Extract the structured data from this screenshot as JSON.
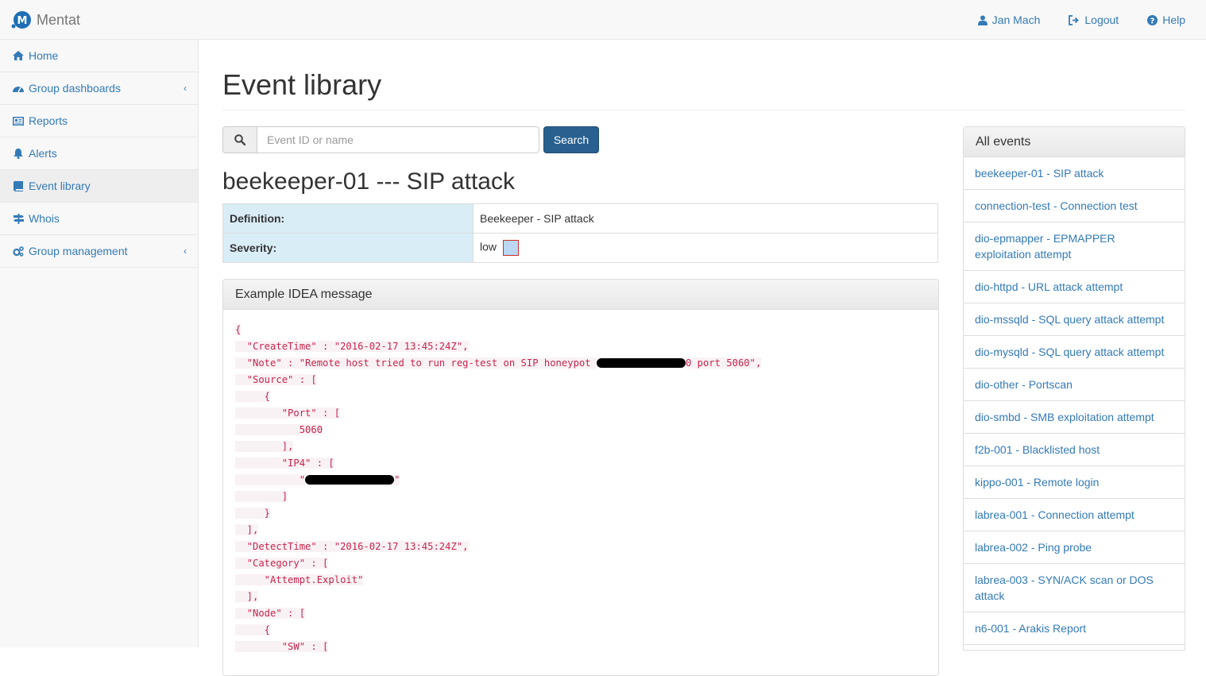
{
  "navbar": {
    "brand": "Mentat",
    "links": [
      {
        "label": "Jan Mach",
        "icon": "user-icon"
      },
      {
        "label": "Logout",
        "icon": "logout-icon"
      },
      {
        "label": "Help",
        "icon": "help-icon"
      }
    ]
  },
  "sidebar": {
    "items": [
      {
        "label": "Home",
        "icon": "home-icon"
      },
      {
        "label": "Group dashboards",
        "icon": "dashboard-icon",
        "has_submenu": true
      },
      {
        "label": "Reports",
        "icon": "newspaper-icon"
      },
      {
        "label": "Alerts",
        "icon": "bell-icon"
      },
      {
        "label": "Event library",
        "icon": "book-icon",
        "active": true
      },
      {
        "label": "Whois",
        "icon": "signpost-icon"
      },
      {
        "label": "Group management",
        "icon": "cogs-icon",
        "has_submenu": true
      }
    ],
    "chevron": "‹"
  },
  "main": {
    "title": "Event library",
    "search": {
      "placeholder": "Event ID or name",
      "button": "Search"
    },
    "event_title": "beekeeper-01 --- SIP attack",
    "definition_label": "Definition:",
    "definition_value": "Beekeeper - SIP attack",
    "severity_label": "Severity:",
    "severity_value": "low",
    "example_panel_title": "Example IDEA message",
    "code_lines": [
      "{",
      "  \"CreateTime\" : \"2016-02-17 13:45:24Z\",",
      "  \"Note\" : \"Remote host tried to run reg-test on SIP honeypot ",
      "  \"Source\" : [",
      "     {",
      "        \"Port\" : [",
      "           5060",
      "        ],",
      "        \"IP4\" : [",
      "           \"",
      "        ]",
      "     }",
      "  ],",
      "  \"DetectTime\" : \"2016-02-17 13:45:24Z\",",
      "  \"Category\" : [",
      "     \"Attempt.Exploit\"",
      "  ],",
      "  \"Node\" : [",
      "     {",
      "        \"SW\" : ["
    ],
    "note_line_suffix": "0 port 5060\",",
    "ip_line_suffix": "\""
  },
  "events_panel": {
    "title": "All events",
    "items": [
      "beekeeper-01 - SIP attack",
      "connection-test - Connection test",
      "dio-epmapper - EPMAPPER exploitation attempt",
      "dio-httpd - URL attack attempt",
      "dio-mssqld - SQL query attack attempt",
      "dio-mysqld - SQL query attack attempt",
      "dio-other - Portscan",
      "dio-smbd - SMB exploitation attempt",
      "f2b-001 - Blacklisted host",
      "kippo-001 - Remote login",
      "labrea-001 - Connection attempt",
      "labrea-002 - Ping probe",
      "labrea-003 - SYN/ACK scan or DOS attack",
      "n6-001 - Arakis Report"
    ]
  },
  "colors": {
    "link": "#337ab7",
    "primary_button": "#286090",
    "code": "#c7254e",
    "label_bg": "#d9edf7"
  }
}
